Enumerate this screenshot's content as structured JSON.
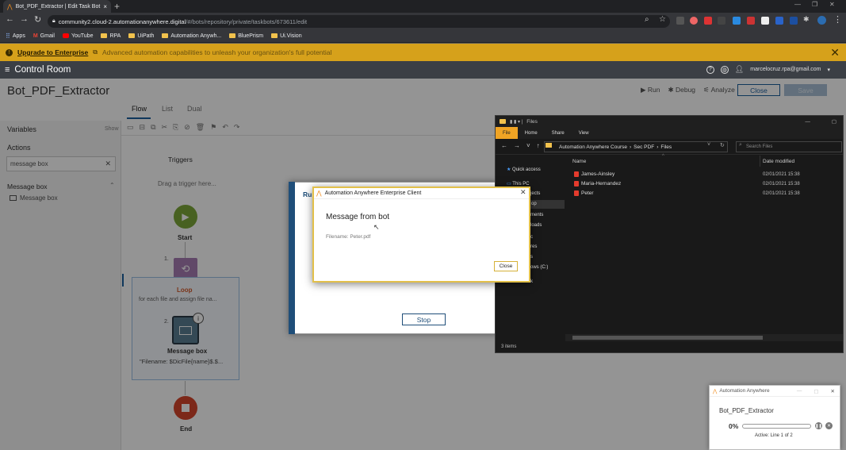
{
  "browser": {
    "tab_title": "Bot_PDF_Extractor | Edit Task Bot",
    "tab_close": "×",
    "new_tab": "+",
    "url_host": "community2.cloud-2.automationanywhere.digital",
    "url_path": "/#/bots/repository/private/taskbots/673611/edit",
    "bookmarks": [
      "Apps",
      "Gmail",
      "YouTube",
      "RPA",
      "UiPath",
      "Automation Anywh...",
      "BluePrism",
      "Ui.Vision"
    ]
  },
  "banner": {
    "link": "Upgrade to Enterprise",
    "message": "Advanced automation capabilities to unleash your organization's full potential",
    "close": "✕"
  },
  "app_header": {
    "title": "Control Room",
    "user": "marcelocruz.rpa@gmail.com"
  },
  "editor": {
    "bot_name": "Bot_PDF_Extractor",
    "actions": {
      "run": "Run",
      "debug": "Debug",
      "analyze": "Analyze"
    },
    "close_label": "Close",
    "save_label": "Save",
    "view_tabs": [
      "Flow",
      "List",
      "Dual"
    ],
    "sidebar": {
      "variables": "Variables",
      "show": "Show",
      "actions": "Actions",
      "search_value": "message box",
      "group": "Message box",
      "item": "Message box"
    },
    "flow": {
      "triggers": "Triggers",
      "drag_hint": "Drag a trigger here...",
      "start": "Start",
      "step1_num": "1.",
      "loop_label": "Loop",
      "loop_desc": "for each file and assign file na...",
      "step2_num": "2.",
      "msgbox_label": "Message box",
      "msgbox_desc": "\"Filename: $DicFile{name}$.$...",
      "end": "End"
    }
  },
  "run_dialog": {
    "title_partial": "Ru",
    "stop_label": "Stop"
  },
  "message_dialog": {
    "title": "Automation Anywhere Enterprise Client",
    "heading": "Message from bot",
    "text": "Filename: Peter.pdf",
    "close_label": "Close"
  },
  "explorer": {
    "title": "Files",
    "menu": [
      "File",
      "Home",
      "Share",
      "View"
    ],
    "path": [
      "Automation Anywhere Course",
      "Sec PDF",
      "Files"
    ],
    "search_placeholder": "Search Files",
    "nav": [
      "Quick access",
      "This PC",
      "jects",
      "op",
      "ments",
      "loads",
      "c",
      "res",
      "s",
      "ows (C:)",
      "Network"
    ],
    "columns": {
      "name": "Name",
      "date": "Date modified"
    },
    "files": [
      {
        "name": "James-Ainsley",
        "date": "02/01/2021 15:38"
      },
      {
        "name": "Maria-Hernandez",
        "date": "02/01/2021 15:38"
      },
      {
        "name": "Peter",
        "date": "02/01/2021 15:38"
      }
    ],
    "status": "3 items"
  },
  "progress_window": {
    "title": "Automation Anywhere",
    "bot": "Bot_PDF_Extractor",
    "percent": "0%",
    "progress_fraction": 0,
    "status": "Active: Line 1 of 2"
  },
  "colors": {
    "banner": "#d6a11b",
    "accent": "#1b5f9e",
    "dialog_border": "#e2c04a"
  }
}
